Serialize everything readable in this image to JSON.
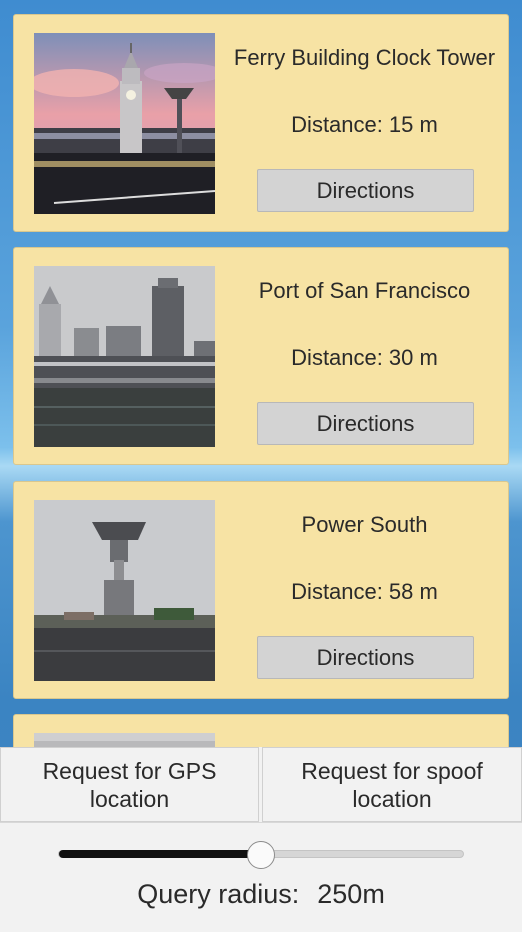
{
  "distance_label": "Distance:",
  "directions_label": "Directions",
  "landmarks": [
    {
      "name": "Ferry Building Clock Tower",
      "distance": "15 m"
    },
    {
      "name": "Port of San Francisco",
      "distance": "30 m"
    },
    {
      "name": "Power South",
      "distance": "58 m"
    },
    {
      "name": "",
      "distance": ""
    }
  ],
  "controls": {
    "gps_button": "Request for GPS location",
    "spoof_button": "Request for spoof location",
    "radius_label": "Query radius:",
    "radius_value": "250m",
    "slider_fraction": 0.5
  },
  "colors": {
    "card_background": "#f7e3a4",
    "button_gray": "#d3d3d3",
    "panel_background": "#f2f2f2"
  }
}
